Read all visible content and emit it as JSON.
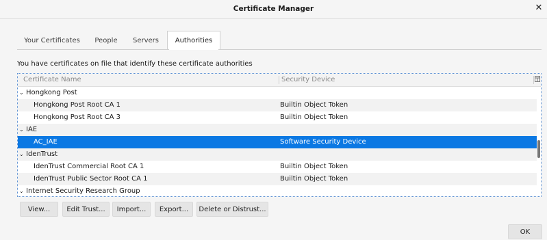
{
  "window": {
    "title": "Certificate Manager",
    "close_glyph": "✕"
  },
  "tabs": [
    {
      "label": "Your Certificates",
      "selected": false
    },
    {
      "label": "People",
      "selected": false
    },
    {
      "label": "Servers",
      "selected": false
    },
    {
      "label": "Authorities",
      "selected": true
    }
  ],
  "description": "You have certificates on file that identify these certificate authorities",
  "table": {
    "columns": {
      "name": "Certificate Name",
      "device": "Security Device"
    },
    "rows": [
      {
        "type": "group",
        "name": "Hongkong Post",
        "device": ""
      },
      {
        "type": "item",
        "name": "Hongkong Post Root CA 1",
        "device": "Builtin Object Token"
      },
      {
        "type": "item",
        "name": "Hongkong Post Root CA 3",
        "device": "Builtin Object Token"
      },
      {
        "type": "group",
        "name": "IAE",
        "device": ""
      },
      {
        "type": "item",
        "name": "AC_IAE",
        "device": "Software Security Device",
        "selected": true
      },
      {
        "type": "group",
        "name": "IdenTrust",
        "device": ""
      },
      {
        "type": "item",
        "name": "IdenTrust Commercial Root CA 1",
        "device": "Builtin Object Token"
      },
      {
        "type": "item",
        "name": "IdenTrust Public Sector Root CA 1",
        "device": "Builtin Object Token"
      },
      {
        "type": "group",
        "name": "Internet Security Research Group",
        "device": ""
      }
    ]
  },
  "buttons": {
    "view": "View...",
    "edit_trust": "Edit Trust...",
    "import": "Import...",
    "export": "Export...",
    "delete": "Delete or Distrust...",
    "ok": "OK"
  },
  "colors": {
    "selection": "#0b78e3",
    "focus_border": "#5b8fd1"
  }
}
